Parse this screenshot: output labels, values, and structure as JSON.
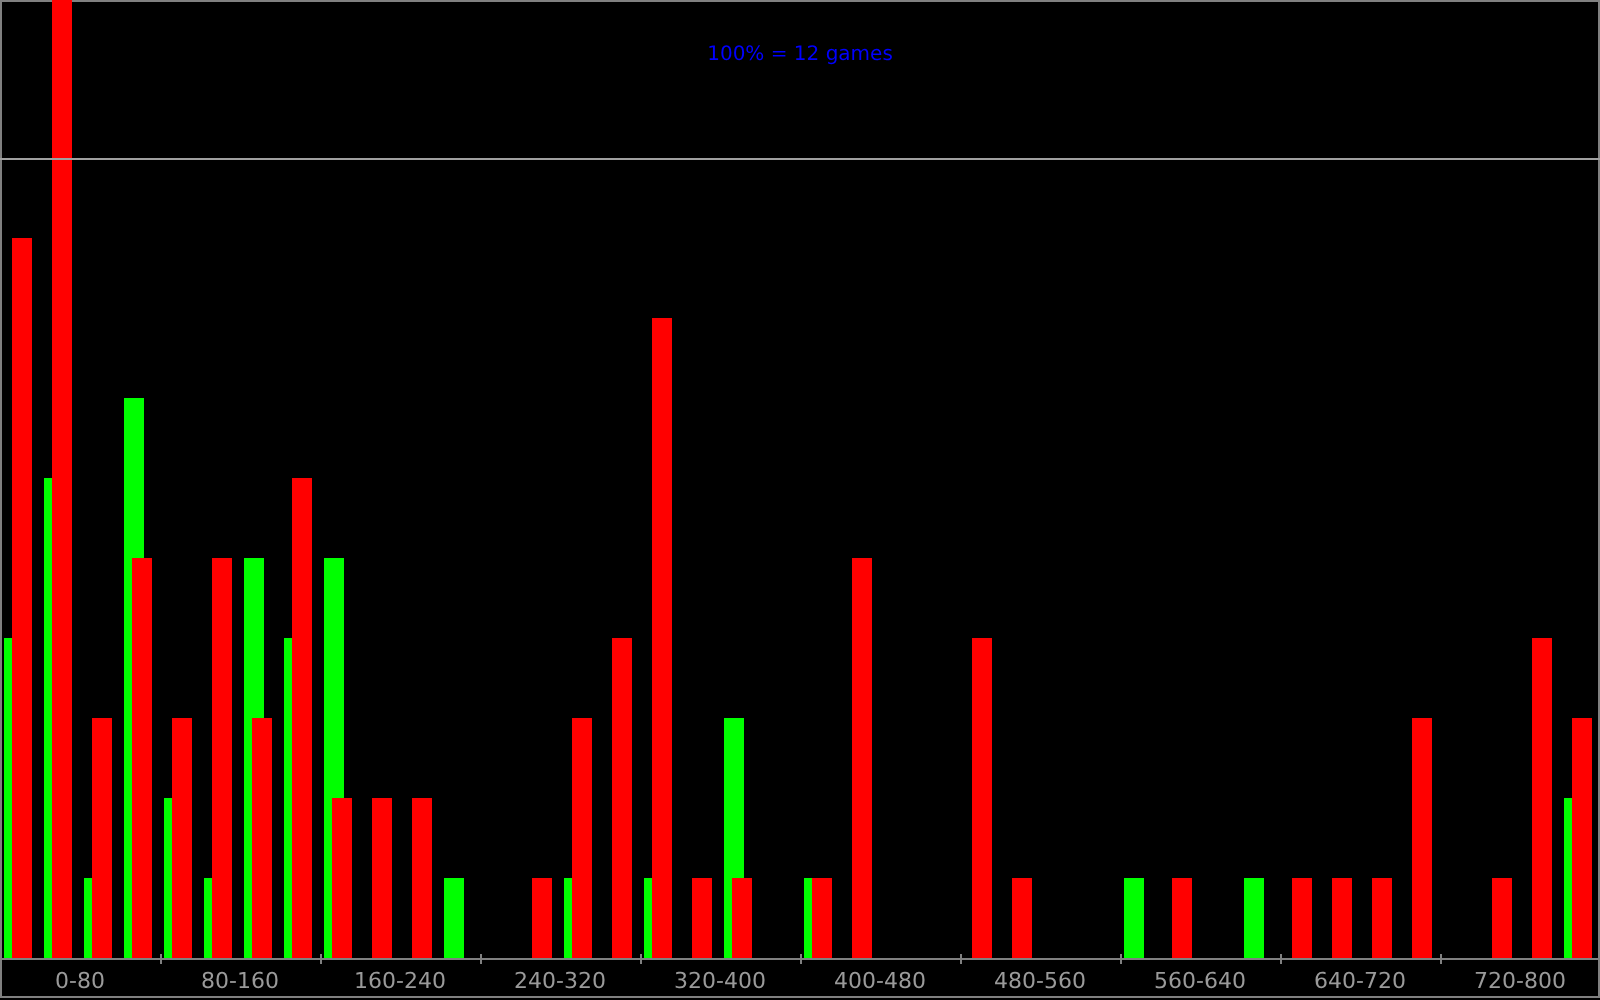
{
  "chart": {
    "reference_label": "100% = 12 games",
    "range_labels": [
      "0-80",
      "80-160",
      "160-240",
      "240-320",
      "320-400",
      "400-480",
      "480-560",
      "560-640",
      "640-720",
      "720-800"
    ]
  }
}
